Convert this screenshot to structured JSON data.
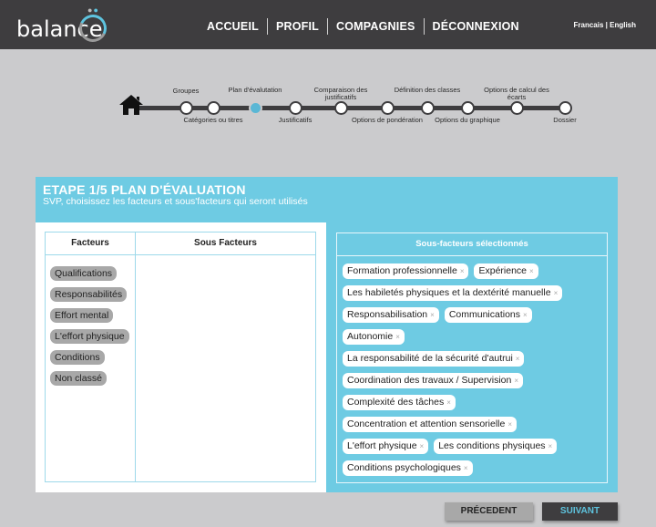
{
  "header": {
    "logo_text": "balance",
    "nav": [
      "ACCUEIL",
      "PROFIL",
      "COMPAGNIES",
      "DÉCONNEXION"
    ],
    "lang": "Francais | English"
  },
  "stepper": {
    "home_icon": "home-icon",
    "current_step": 3,
    "steps": [
      {
        "label": "Groupes",
        "pos": "top"
      },
      {
        "label": "Catégories ou titres",
        "pos": "bottom"
      },
      {
        "label": "Plan d'évalutation",
        "pos": "top"
      },
      {
        "label": "Justificatifs",
        "pos": "bottom"
      },
      {
        "label": "Comparaison des justificatifs",
        "pos": "top"
      },
      {
        "label": "Options de pondération",
        "pos": "bottom"
      },
      {
        "label": "Définition des classes",
        "pos": "top"
      },
      {
        "label": "Options du graphique",
        "pos": "bottom"
      },
      {
        "label": "Options de calcul des écarts",
        "pos": "top"
      },
      {
        "label": "Dossier",
        "pos": "bottom"
      }
    ]
  },
  "card": {
    "title": "ETAPE 1/5 PLAN D'ÉVALUATION",
    "subtitle": "SVP, choisissez les facteurs et sous'facteurs qui seront utilisés",
    "table": {
      "col_facteurs": "Facteurs",
      "col_sous_facteurs": "Sous Facteurs",
      "facteurs": [
        "Qualifications",
        "Responsabilités",
        "Effort mental",
        "L'effort physique",
        "Conditions",
        "Non classé"
      ]
    },
    "selected": {
      "title": "Sous-facteurs sélectionnés",
      "remove_icon": "×",
      "rows": [
        [
          "Formation professionnelle",
          "Expérience"
        ],
        [
          "Les habiletés physiques et la dextérité manuelle"
        ],
        [
          "Responsabilisation",
          "Communications"
        ],
        [
          "Autonomie"
        ],
        [
          "La responsabilité de la sécurité d'autrui"
        ],
        [
          "Coordination des travaux / Supervision"
        ],
        [
          "Complexité des tâches"
        ],
        [
          "Concentration et attention sensorielle"
        ],
        [
          "L'effort physique",
          "Les conditions physiques"
        ],
        [
          "Conditions psychologiques"
        ]
      ]
    }
  },
  "buttons": {
    "prev": "PRÉCEDENT",
    "next": "SUIVANT"
  }
}
